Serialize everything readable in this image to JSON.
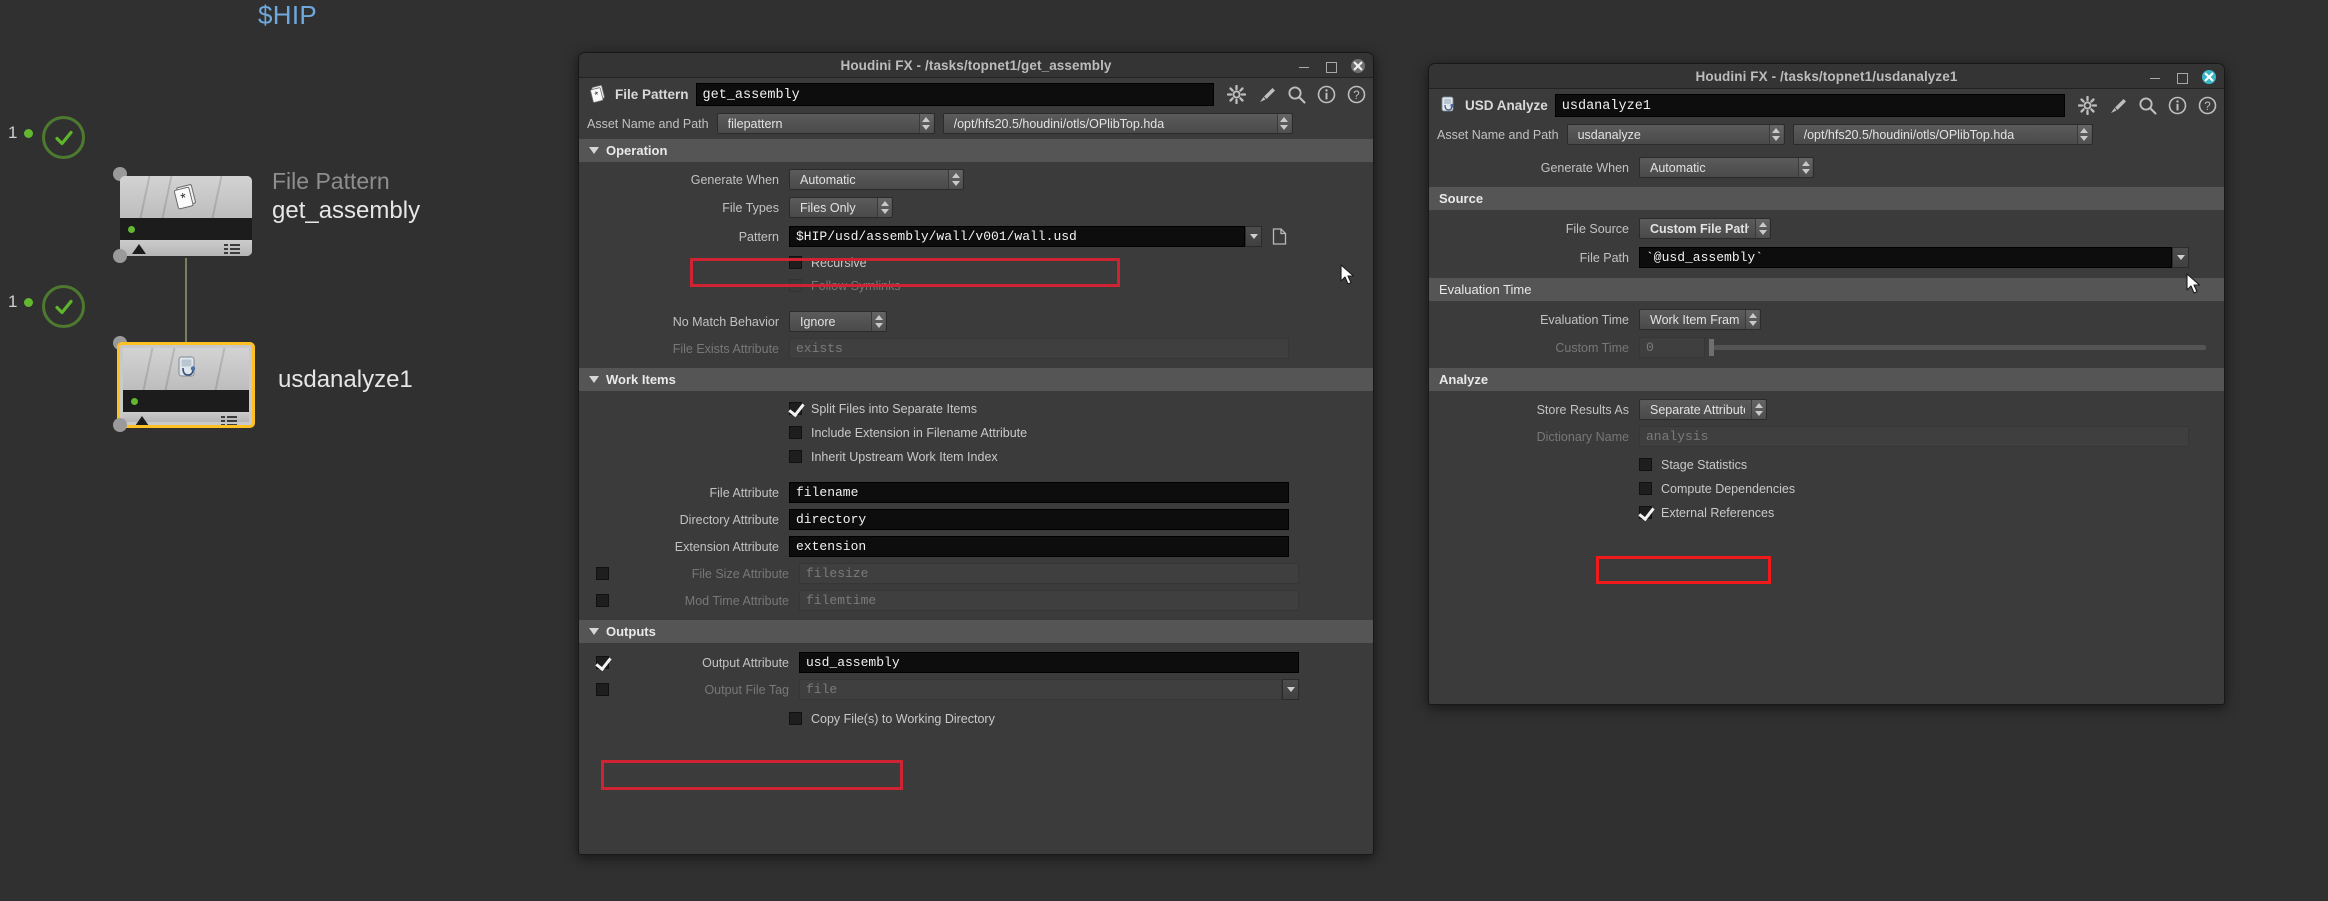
{
  "graph": {
    "hip_label": "$HIP",
    "nodes": [
      {
        "badge_count": "1",
        "type_label": "File Pattern",
        "name": "get_assembly",
        "icon": "file-pattern-icon",
        "selected": false
      },
      {
        "badge_count": "1",
        "type_label": "",
        "name": "usdanalyze1",
        "icon": "usd-analyze-icon",
        "selected": true
      }
    ]
  },
  "window_left": {
    "title": "Houdini FX - /tasks/topnet1/get_assembly",
    "buttons": {
      "minimize": "minimize",
      "maximize": "maximize",
      "close": "close"
    },
    "op_type": "File Pattern",
    "op_name": "get_assembly",
    "header_icons": [
      "gear-icon",
      "brush-icon",
      "search-icon",
      "info-icon",
      "help-icon"
    ],
    "asset_row": {
      "label": "Asset Name and Path",
      "asset_name": "filepattern",
      "asset_path": "/opt/hfs20.5/houdini/otls/OPlibTop.hda"
    },
    "sections": {
      "operation": {
        "title": "Operation",
        "generate_when_label": "Generate When",
        "generate_when_value": "Automatic",
        "file_types_label": "File Types",
        "file_types_value": "Files Only",
        "pattern_label": "Pattern",
        "pattern_value": "$HIP/usd/assembly/wall/v001/wall.usd",
        "recursive_label": "Recursive",
        "recursive_checked": false,
        "follow_symlinks_label": "Follow Symlinks",
        "follow_symlinks_checked": false,
        "no_match_label": "No Match Behavior",
        "no_match_value": "Ignore",
        "file_exists_label": "File Exists Attribute",
        "file_exists_value": "exists"
      },
      "work_items": {
        "title": "Work Items",
        "checkboxes": [
          {
            "label": "Split Files into Separate Items",
            "checked": true
          },
          {
            "label": "Include Extension in Filename Attribute",
            "checked": false
          },
          {
            "label": "Inherit Upstream Work Item Index",
            "checked": false
          }
        ],
        "attributes": [
          {
            "label": "File Attribute",
            "value": "filename",
            "dim": false,
            "has_checkbox": false
          },
          {
            "label": "Directory Attribute",
            "value": "directory",
            "dim": false,
            "has_checkbox": false
          },
          {
            "label": "Extension Attribute",
            "value": "extension",
            "dim": false,
            "has_checkbox": false
          },
          {
            "label": "File Size Attribute",
            "value": "filesize",
            "dim": true,
            "has_checkbox": true
          },
          {
            "label": "Mod Time Attribute",
            "value": "filemtime",
            "dim": true,
            "has_checkbox": true
          }
        ]
      },
      "outputs": {
        "title": "Outputs",
        "output_attribute_label": "Output Attribute",
        "output_attribute_value": "usd_assembly",
        "output_attribute_checked": true,
        "output_file_tag_label": "Output File Tag",
        "output_file_tag_value": "file",
        "output_file_tag_checked": false,
        "copy_files_label": "Copy File(s) to Working Directory",
        "copy_files_checked": false
      }
    }
  },
  "window_right": {
    "title": "Houdini FX - /tasks/topnet1/usdanalyze1",
    "op_type": "USD Analyze",
    "op_name": "usdanalyze1",
    "header_icons": [
      "gear-icon",
      "brush-icon",
      "search-icon",
      "info-icon",
      "help-icon"
    ],
    "asset_row": {
      "label": "Asset Name and Path",
      "asset_name": "usdanalyze",
      "asset_path": "/opt/hfs20.5/houdini/otls/OPlibTop.hda"
    },
    "generate_when_label": "Generate When",
    "generate_when_value": "Automatic",
    "sections": {
      "source": {
        "title": "Source",
        "file_source_label": "File Source",
        "file_source_value": "Custom File Path",
        "file_path_label": "File Path",
        "file_path_value": "`@usd_assembly`"
      },
      "evaluation_time": {
        "title": "Evaluation Time",
        "eval_time_label": "Evaluation Time",
        "eval_time_value": "Work Item Frame",
        "custom_time_label": "Custom Time",
        "custom_time_value": "0"
      },
      "analyze": {
        "title": "Analyze",
        "store_results_label": "Store Results As",
        "store_results_value": "Separate Attributes",
        "dictionary_name_label": "Dictionary Name",
        "dictionary_name_value": "analysis",
        "checkboxes": [
          {
            "label": "Stage Statistics",
            "checked": false
          },
          {
            "label": "Compute Dependencies",
            "checked": false
          },
          {
            "label": "External References",
            "checked": true
          }
        ]
      }
    }
  },
  "colors": {
    "highlight_red": "#cf2233",
    "highlight_red_bright": "#f01a1a",
    "selected_node": "#ffc024",
    "ok_green": "#63b830",
    "hip_blue": "#6fa8dc",
    "close_active": "#3ab7c6"
  }
}
